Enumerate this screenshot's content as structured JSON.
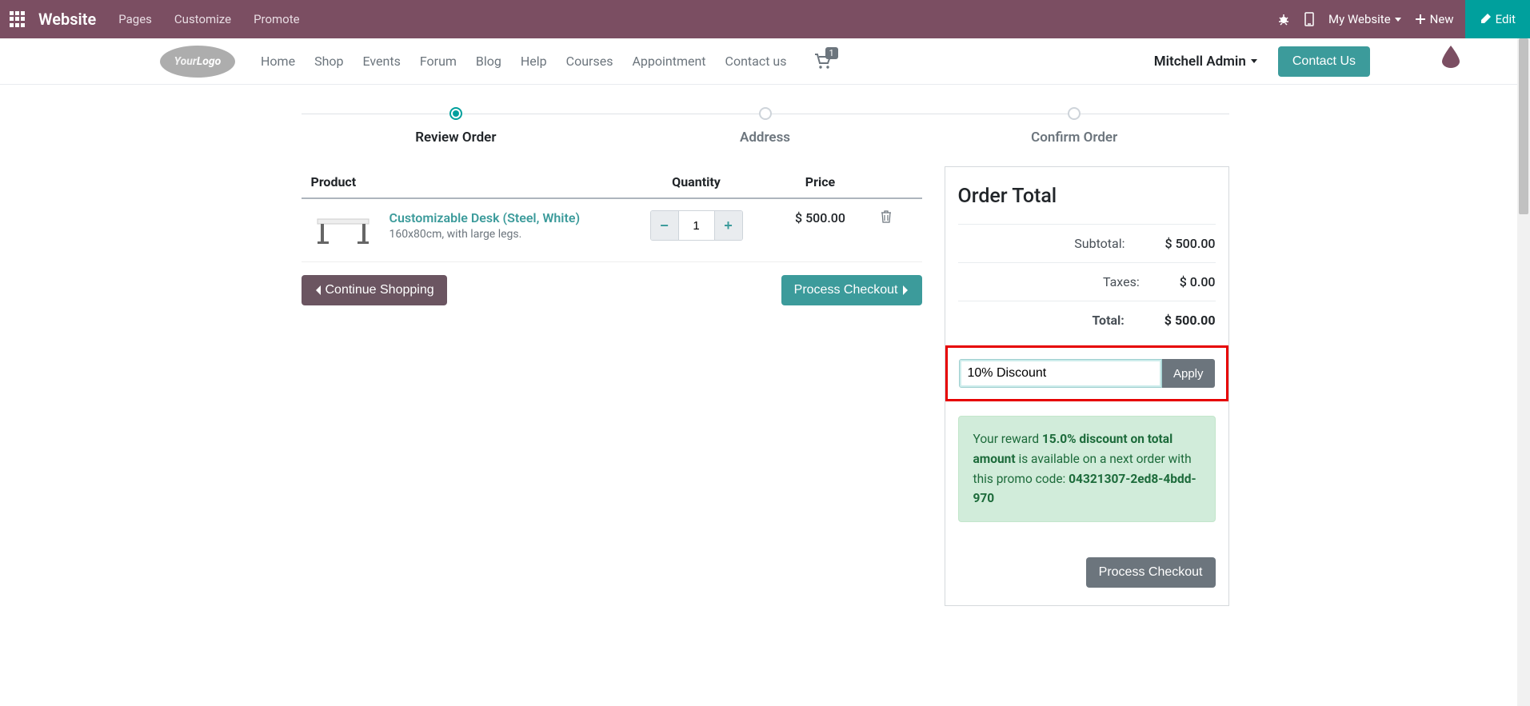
{
  "topbar": {
    "brand": "Website",
    "menu": [
      "Pages",
      "Customize",
      "Promote"
    ],
    "my_website": "My Website",
    "new": "New",
    "edit": "Edit"
  },
  "header": {
    "logo_text": "YourLogo",
    "nav": [
      "Home",
      "Shop",
      "Events",
      "Forum",
      "Blog",
      "Help",
      "Courses",
      "Appointment",
      "Contact us"
    ],
    "cart_count": "1",
    "user": "Mitchell Admin",
    "contact": "Contact Us"
  },
  "steps": [
    {
      "label": "Review Order",
      "active": true
    },
    {
      "label": "Address",
      "active": false
    },
    {
      "label": "Confirm Order",
      "active": false
    }
  ],
  "cart": {
    "headers": {
      "product": "Product",
      "quantity": "Quantity",
      "price": "Price"
    },
    "items": [
      {
        "name": "Customizable Desk (Steel, White)",
        "desc": "160x80cm, with large legs.",
        "qty": "1",
        "price": "$ 500.00"
      }
    ]
  },
  "actions": {
    "continue": "Continue Shopping",
    "checkout": "Process Checkout"
  },
  "summary": {
    "title": "Order Total",
    "subtotal_label": "Subtotal:",
    "subtotal_value": "$ 500.00",
    "taxes_label": "Taxes:",
    "taxes_value": "$ 0.00",
    "total_label": "Total:",
    "total_value": "$ 500.00",
    "promo_value": "10% Discount",
    "apply": "Apply",
    "reward_prefix": "Your reward ",
    "reward_bold1": "15.0% discount on total amount",
    "reward_mid": " is available on a next order with this promo code: ",
    "reward_code": "04321307-2ed8-4bdd-970",
    "process": "Process Checkout"
  }
}
